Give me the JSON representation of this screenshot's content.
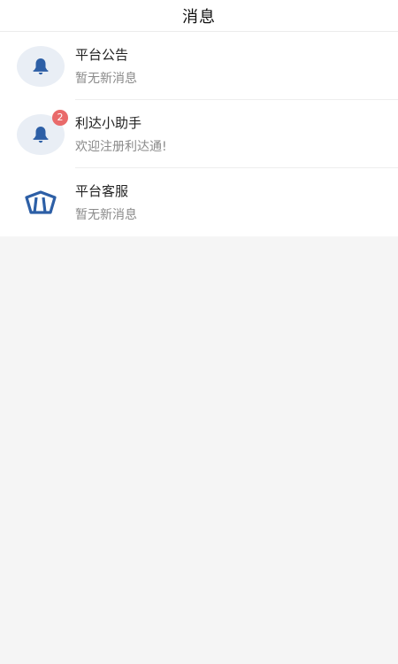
{
  "header": {
    "title": "消息"
  },
  "colors": {
    "icon_blue": "#2d5fa6",
    "badge_red": "#e96a6a",
    "avatar_bg": "#e9eef5"
  },
  "messages": [
    {
      "title": "平台公告",
      "subtitle": "暂无新消息",
      "icon": "bell-icon",
      "badge": ""
    },
    {
      "title": "利达小助手",
      "subtitle": "欢迎注册利达通!",
      "icon": "bell-icon",
      "badge": "2"
    },
    {
      "title": "平台客服",
      "subtitle": "暂无新消息",
      "icon": "service-logo-icon",
      "badge": ""
    }
  ]
}
